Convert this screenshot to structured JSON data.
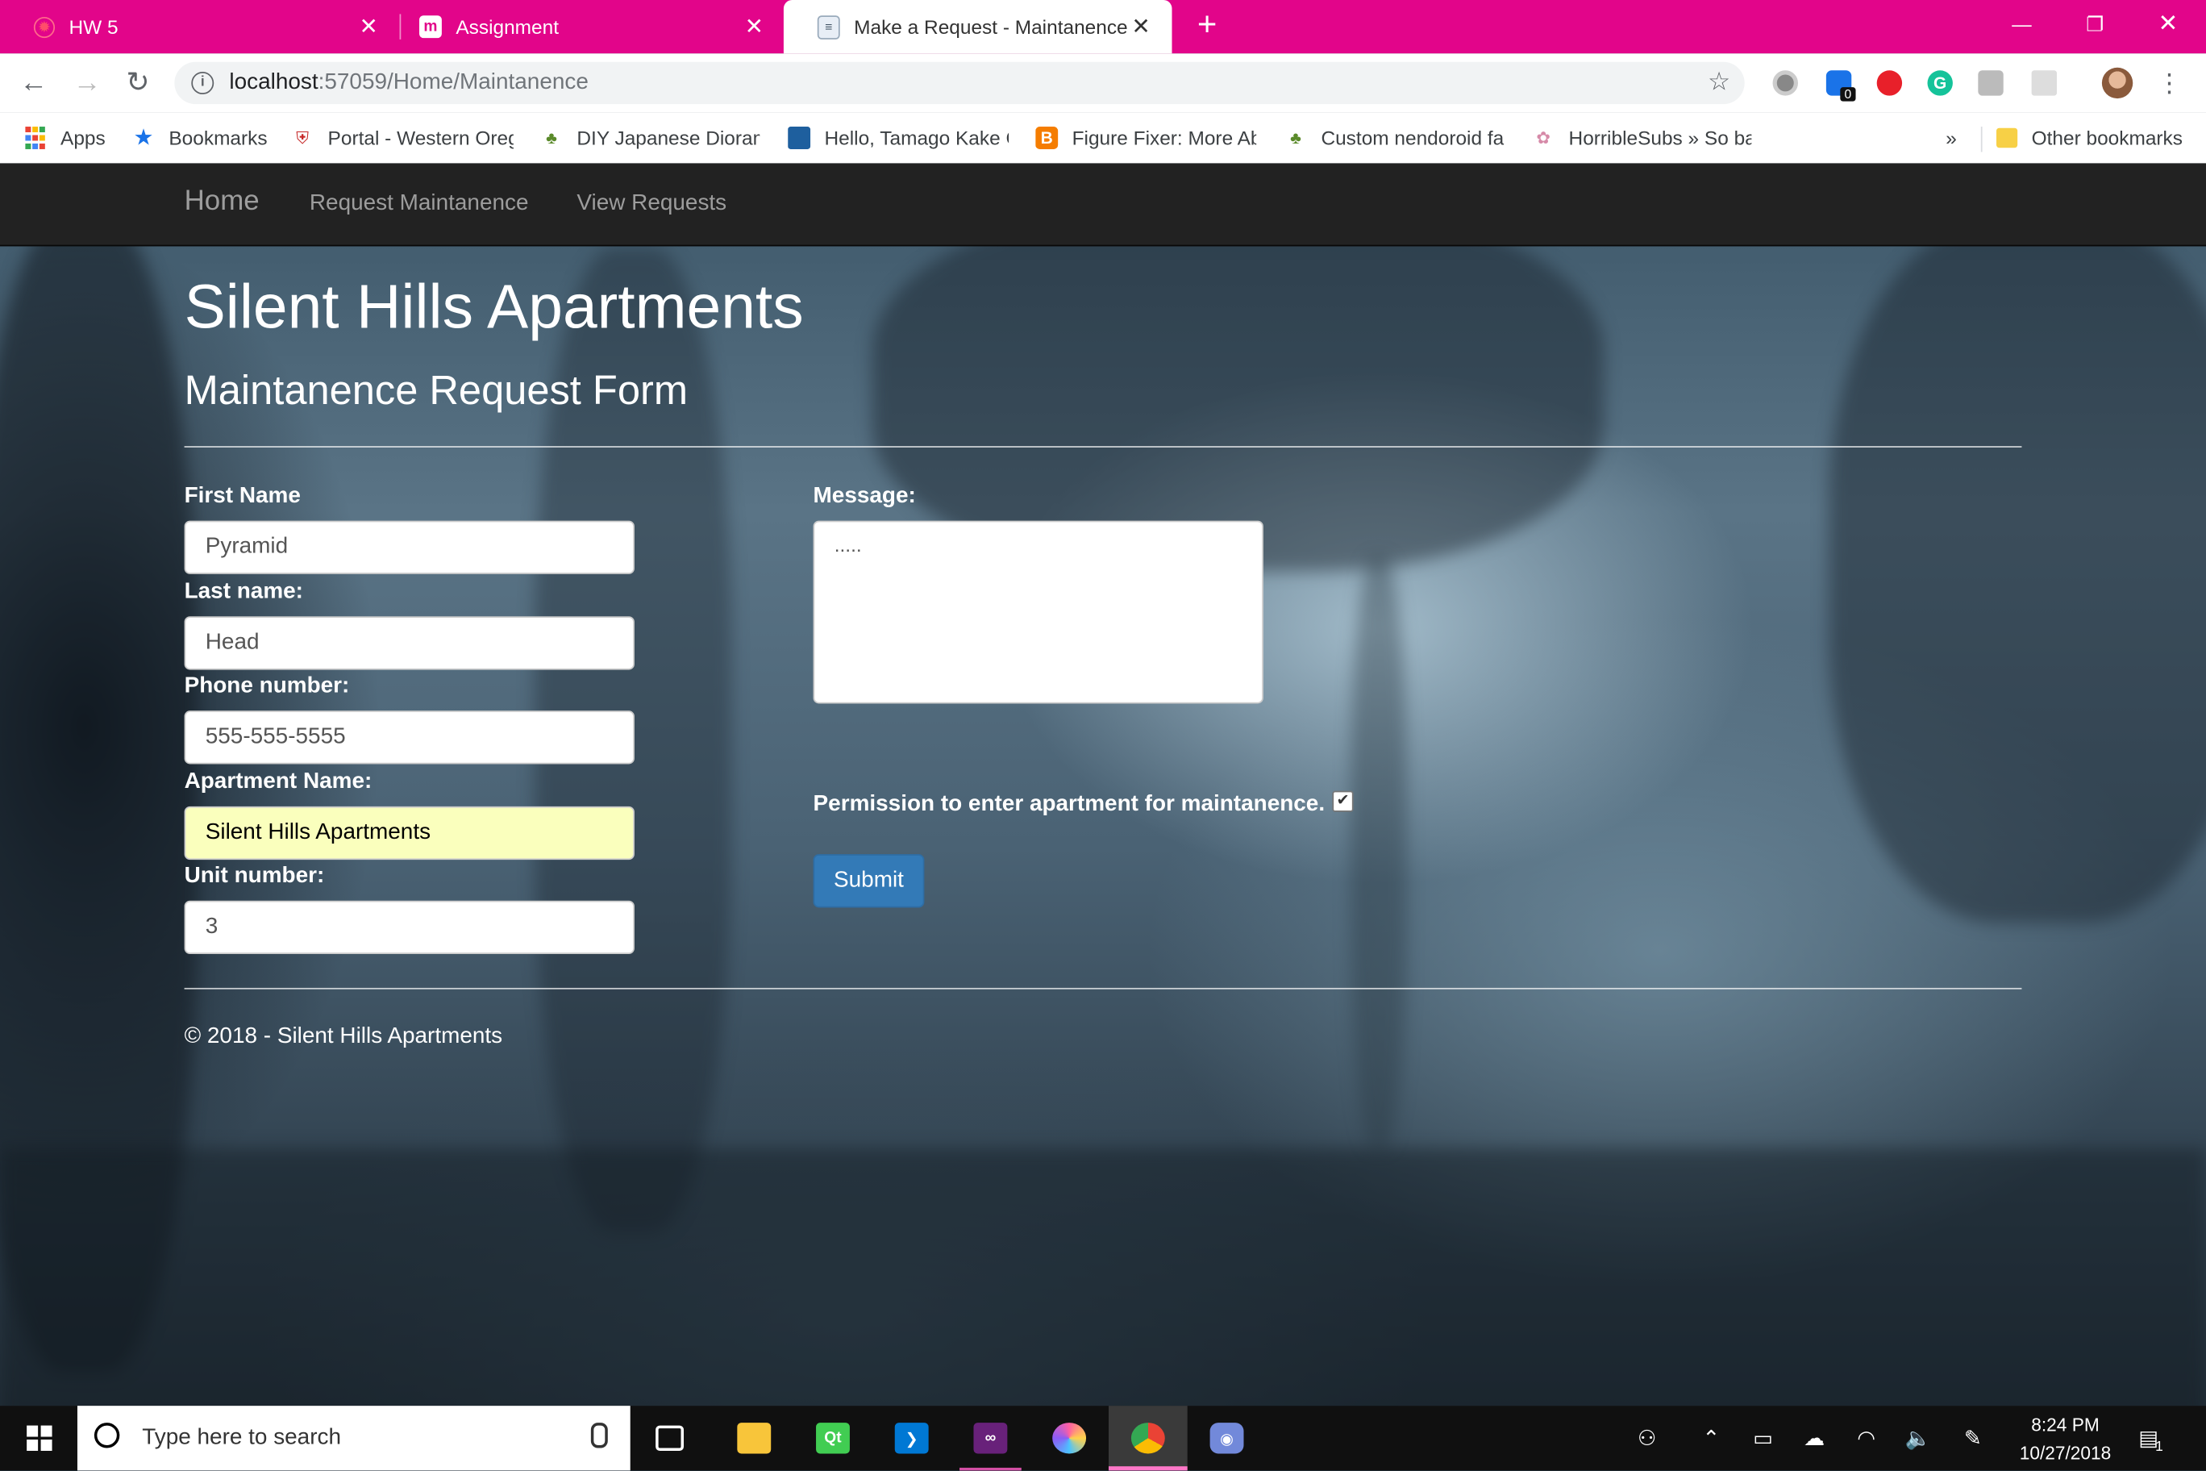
{
  "browser": {
    "tabs": [
      {
        "title": "HW 5",
        "close": "✕"
      },
      {
        "title": "Assignment",
        "close": "✕"
      },
      {
        "title": "Make a Request - Maintanence",
        "close": "✕"
      }
    ],
    "new_tab": "+",
    "window_controls": {
      "minimize": "—",
      "restore": "❐",
      "close": "✕"
    },
    "url_host": "localhost",
    "url_rest": ":57059/Home/Maintanence",
    "extensions": {
      "badge_count": "0"
    },
    "bookmarks": [
      {
        "label": "Apps"
      },
      {
        "label": "Bookmarks"
      },
      {
        "label": "Portal - Western Oreg"
      },
      {
        "label": "DIY Japanese Dioram"
      },
      {
        "label": "Hello, Tamago Kake G"
      },
      {
        "label": "Figure Fixer: More Ab"
      },
      {
        "label": "Custom nendoroid fa"
      },
      {
        "label": "HorribleSubs » So ba"
      }
    ],
    "more_bookmarks": "»",
    "other_bookmarks": "Other bookmarks"
  },
  "site": {
    "nav": {
      "brand": "Home",
      "links": [
        "Request Maintanence",
        "View Requests"
      ]
    },
    "title": "Silent Hills Apartments",
    "subtitle": "Maintanence Request Form",
    "form": {
      "first_name": {
        "label": "First Name",
        "value": "Pyramid"
      },
      "last_name": {
        "label": "Last name:",
        "value": "Head"
      },
      "phone": {
        "label": "Phone number:",
        "value": "555-555-5555"
      },
      "apartment": {
        "label": "Apartment Name:",
        "value": "Silent Hills Apartments"
      },
      "unit": {
        "label": "Unit number:",
        "value": "3"
      },
      "message": {
        "label": "Message:",
        "value": "....."
      },
      "permission": {
        "label": "Permission to enter apartment for maintanence.",
        "checked": true,
        "mark": "✔"
      },
      "submit_label": "Submit"
    },
    "footer": "© 2018 - Silent Hills Apartments"
  },
  "taskbar": {
    "search_placeholder": "Type here to search",
    "apps": [
      "task-view",
      "file-explorer",
      "qt-creator",
      "vs-code",
      "visual-studio",
      "paint-app",
      "chrome",
      "discord"
    ],
    "clock_time": "8:24 PM",
    "clock_date": "10/27/2018",
    "notification_count": "1"
  }
}
